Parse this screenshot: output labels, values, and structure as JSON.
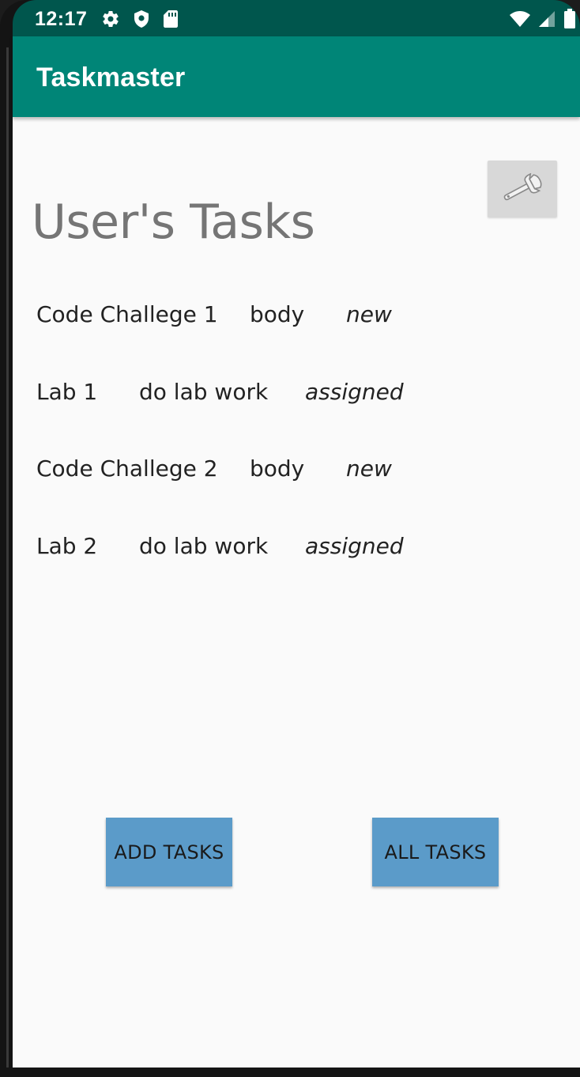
{
  "status_bar": {
    "time": "12:17",
    "left_icons": [
      "gear-icon",
      "shield-icon",
      "sd-card-icon"
    ],
    "right_icons": [
      "wifi-icon",
      "cell-signal-icon",
      "battery-icon"
    ]
  },
  "app_bar": {
    "title": "Taskmaster"
  },
  "main": {
    "title": "User's Tasks",
    "settings_icon": "wrench-icon",
    "tasks": [
      {
        "title": "Code Challege 1",
        "body": "body",
        "state": "new"
      },
      {
        "title": "Lab 1",
        "body": "do lab work",
        "state": "assigned"
      },
      {
        "title": "Code Challege 2",
        "body": "body",
        "state": "new"
      },
      {
        "title": "Lab 2",
        "body": "do lab work",
        "state": "assigned"
      }
    ],
    "buttons": {
      "add_tasks": "ADD TASKS",
      "all_tasks": "ALL TASKS"
    }
  },
  "colors": {
    "status_bar": "#00564d",
    "app_bar": "#008577",
    "background": "#fafafa",
    "button": "#5b9bc9"
  }
}
